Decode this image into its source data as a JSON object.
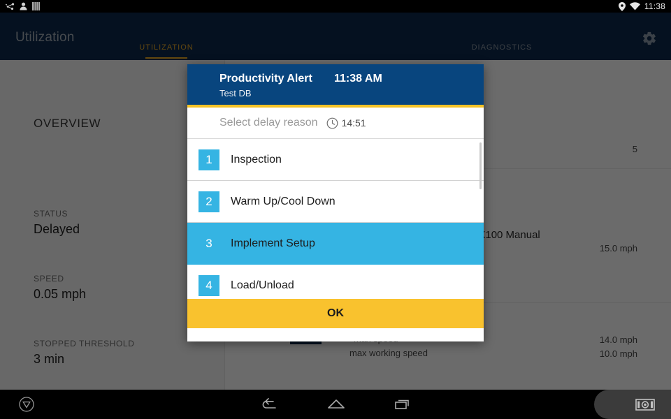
{
  "statusbar": {
    "icons_left": [
      "share-nodes-icon",
      "person-icon",
      "sim-bars-icon"
    ],
    "icons_right": [
      "location-pin-icon",
      "wifi-icon"
    ],
    "time": "11:38"
  },
  "appbar": {
    "title": "Utilization",
    "settings_icon": "gear-icon",
    "tabs": [
      {
        "label": "UTILIZATION",
        "active": true,
        "color": "#c8901f"
      },
      {
        "label": "DIAGNOSTICS",
        "active": false,
        "color": "#78808a"
      }
    ]
  },
  "content": {
    "section_title": "OVERVIEW",
    "fields": [
      {
        "key": "STATUS",
        "value": "Delayed"
      },
      {
        "key": "SPEED",
        "value": "0.05 mph"
      },
      {
        "key": "STOPPED THRESHOLD",
        "value": "3 min"
      }
    ],
    "right": {
      "count": "5",
      "implement": "1X100 Manual",
      "max_speed_value": "15.0 mph",
      "speed_value_2": "14.0 mph",
      "speed_value_3": "10.0 mph",
      "caption_1": "max speed",
      "caption_2": "max working speed"
    }
  },
  "dialog": {
    "title": "Productivity Alert",
    "time": "11:38 AM",
    "subtitle": "Test DB",
    "prompt": "Select delay reason",
    "timer_icon": "clock-icon",
    "timer": "14:51",
    "options": [
      {
        "number": "1",
        "label": "Inspection",
        "selected": false
      },
      {
        "number": "2",
        "label": "Warm Up/Cool Down",
        "selected": false
      },
      {
        "number": "3",
        "label": "Implement Setup",
        "selected": true
      },
      {
        "number": "4",
        "label": "Load/Unload",
        "selected": false
      }
    ],
    "confirm_label": "OK",
    "colors": {
      "header": "#08457e",
      "accent_yellow": "#f9c22e",
      "accent_blue": "#35b4e3"
    }
  },
  "navbar": {
    "buttons": [
      "assist-circle-icon",
      "back-icon",
      "home-icon",
      "recents-icon",
      "screenshot-camera-icon"
    ]
  }
}
